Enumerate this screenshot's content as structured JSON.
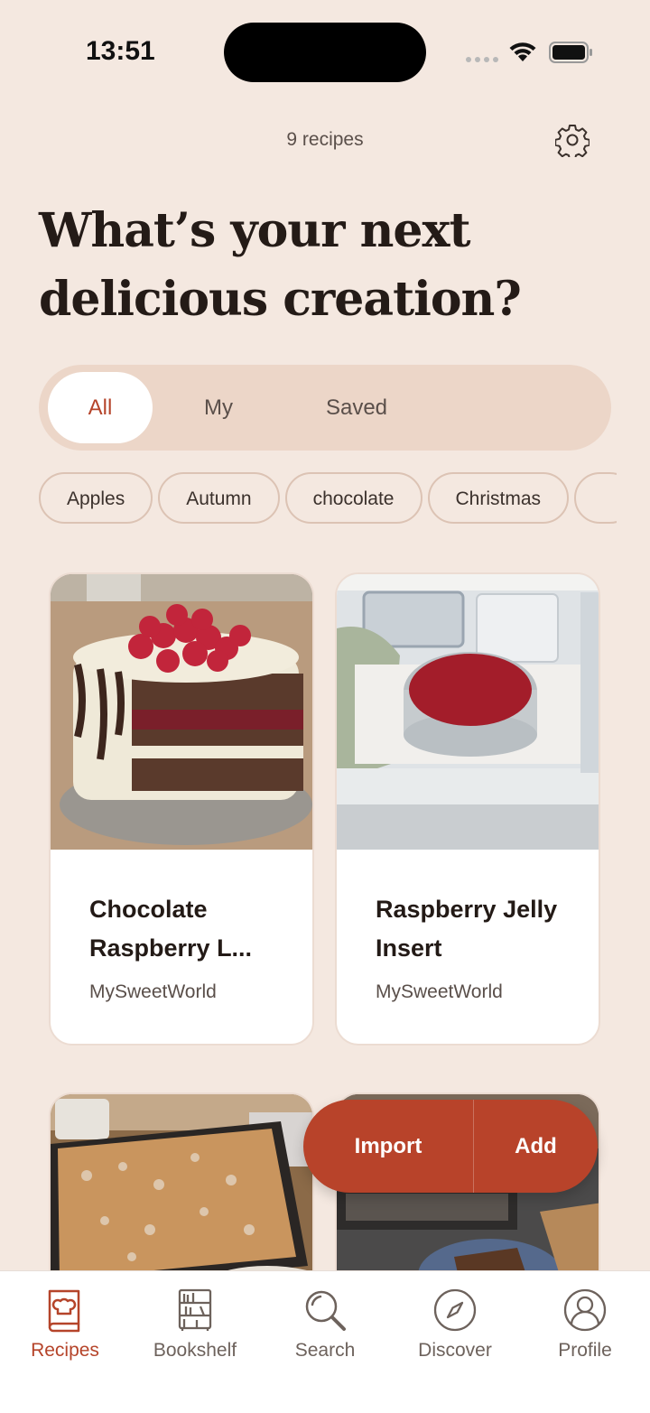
{
  "status_bar": {
    "time": "13:51"
  },
  "header": {
    "recipe_count": "9 recipes",
    "headline": "What’s your next delicious creation?"
  },
  "segments": {
    "all": "All",
    "my": "My",
    "saved": "Saved",
    "selected": "All"
  },
  "chips": [
    "Apples",
    "Autumn",
    "chocolate",
    "Christmas"
  ],
  "recipes": [
    {
      "title": "Chocolate Raspberry L...",
      "author": "MySweetWorld"
    },
    {
      "title": "Raspberry Jelly Insert",
      "author": "MySweetWorld"
    }
  ],
  "fab": {
    "import": "Import",
    "add": "Add"
  },
  "tabs": {
    "recipes": "Recipes",
    "bookshelf": "Bookshelf",
    "search": "Search",
    "discover": "Discover",
    "profile": "Profile"
  },
  "colors": {
    "accent": "#b8432a",
    "background": "#f4e8e0",
    "segment_bg": "#ecd6c8"
  }
}
